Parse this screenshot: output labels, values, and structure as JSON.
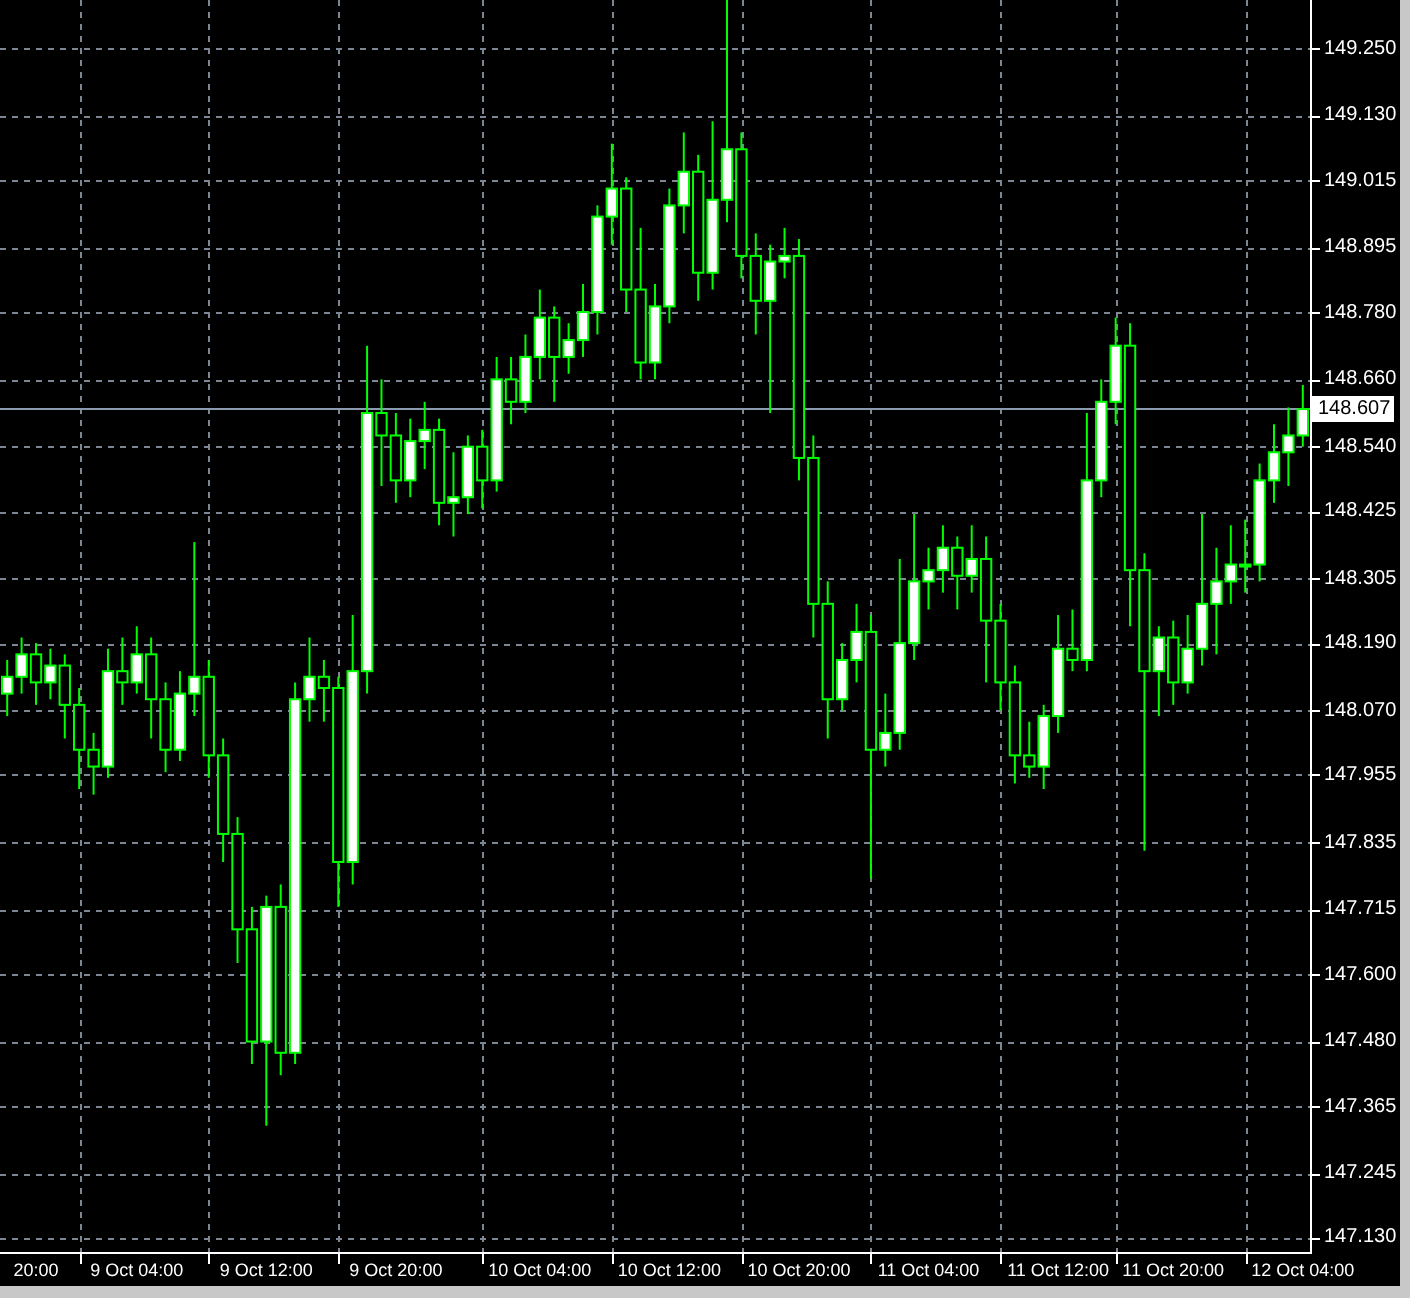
{
  "chart_data": {
    "type": "candlestick",
    "ylim": [
      147.105,
      149.336
    ],
    "grid": true,
    "ref_lines": [
      {
        "axis": "y",
        "value": 148.607,
        "label": "148.607",
        "color": "#8a9bb0"
      }
    ],
    "yticks": [
      {
        "value": 149.25,
        "label": "149.250"
      },
      {
        "value": 149.13,
        "label": "149.130"
      },
      {
        "value": 149.015,
        "label": "149.015"
      },
      {
        "value": 148.895,
        "label": "148.895"
      },
      {
        "value": 148.78,
        "label": "148.780"
      },
      {
        "value": 148.66,
        "label": "148.660"
      },
      {
        "value": 148.54,
        "label": "148.540"
      },
      {
        "value": 148.425,
        "label": "148.425"
      },
      {
        "value": 148.305,
        "label": "148.305"
      },
      {
        "value": 148.19,
        "label": "148.190"
      },
      {
        "value": 148.07,
        "label": "148.070"
      },
      {
        "value": 147.955,
        "label": "147.955"
      },
      {
        "value": 147.835,
        "label": "147.835"
      },
      {
        "value": 147.715,
        "label": "147.715"
      },
      {
        "value": 147.6,
        "label": "147.600"
      },
      {
        "value": 147.48,
        "label": "147.480"
      },
      {
        "value": 147.365,
        "label": "147.365"
      },
      {
        "value": 147.245,
        "label": "147.245"
      },
      {
        "value": 147.13,
        "label": "147.130"
      }
    ],
    "categories": [
      null,
      null,
      "20:00",
      null,
      null,
      null,
      null,
      null,
      null,
      "9 Oct 04:00",
      null,
      null,
      null,
      null,
      null,
      null,
      null,
      null,
      "9 Oct 12:00",
      null,
      null,
      null,
      null,
      null,
      null,
      null,
      null,
      "9 Oct 20:00",
      null,
      null,
      null,
      null,
      null,
      null,
      null,
      null,
      null,
      "10 Oct 04:00",
      null,
      null,
      null,
      null,
      null,
      null,
      null,
      null,
      "10 Oct 12:00",
      null,
      null,
      null,
      null,
      null,
      null,
      null,
      null,
      "10 Oct 20:00",
      null,
      null,
      null,
      null,
      null,
      null,
      null,
      null,
      "11 Oct 04:00",
      null,
      null,
      null,
      null,
      null,
      null,
      null,
      null,
      "11 Oct 12:00",
      null,
      null,
      null,
      null,
      null,
      null,
      null,
      "11 Oct 20:00",
      null,
      null,
      null,
      null,
      null,
      null,
      null,
      null,
      "12 Oct 04:00"
    ],
    "ohlc": [
      [
        148.1,
        148.16,
        148.06,
        148.13
      ],
      [
        148.13,
        148.2,
        148.1,
        148.17
      ],
      [
        148.17,
        148.19,
        148.08,
        148.12
      ],
      [
        148.12,
        148.18,
        148.09,
        148.15
      ],
      [
        148.15,
        148.17,
        148.02,
        148.08
      ],
      [
        148.08,
        148.11,
        147.93,
        148.0
      ],
      [
        148.0,
        148.03,
        147.92,
        147.97
      ],
      [
        147.97,
        148.18,
        147.95,
        148.14
      ],
      [
        148.14,
        148.2,
        148.08,
        148.12
      ],
      [
        148.12,
        148.22,
        148.1,
        148.17
      ],
      [
        148.17,
        148.2,
        148.02,
        148.09
      ],
      [
        148.09,
        148.12,
        147.96,
        148.0
      ],
      [
        148.0,
        148.14,
        147.98,
        148.1
      ],
      [
        148.1,
        148.37,
        148.06,
        148.13
      ],
      [
        148.13,
        148.16,
        147.95,
        147.99
      ],
      [
        147.99,
        148.02,
        147.8,
        147.85
      ],
      [
        147.85,
        147.88,
        147.62,
        147.68
      ],
      [
        147.68,
        147.72,
        147.44,
        147.48
      ],
      [
        147.48,
        147.74,
        147.33,
        147.72
      ],
      [
        147.72,
        147.76,
        147.42,
        147.46
      ],
      [
        147.46,
        148.12,
        147.44,
        148.09
      ],
      [
        148.09,
        148.2,
        148.05,
        148.13
      ],
      [
        148.13,
        148.16,
        148.05,
        148.11
      ],
      [
        148.11,
        148.13,
        147.72,
        147.8
      ],
      [
        147.8,
        148.24,
        147.76,
        148.14
      ],
      [
        148.14,
        148.72,
        148.1,
        148.6
      ],
      [
        148.6,
        148.66,
        148.47,
        148.56
      ],
      [
        148.56,
        148.6,
        148.44,
        148.48
      ],
      [
        148.48,
        148.59,
        148.45,
        148.55
      ],
      [
        148.55,
        148.62,
        148.5,
        148.57
      ],
      [
        148.57,
        148.59,
        148.4,
        148.44
      ],
      [
        148.44,
        148.53,
        148.38,
        148.45
      ],
      [
        148.45,
        148.56,
        148.42,
        148.54
      ],
      [
        148.54,
        148.57,
        148.43,
        148.48
      ],
      [
        148.48,
        148.7,
        148.46,
        148.66
      ],
      [
        148.66,
        148.7,
        148.58,
        148.62
      ],
      [
        148.62,
        148.74,
        148.6,
        148.7
      ],
      [
        148.7,
        148.82,
        148.66,
        148.77
      ],
      [
        148.77,
        148.79,
        148.62,
        148.7
      ],
      [
        148.7,
        148.76,
        148.67,
        148.73
      ],
      [
        148.73,
        148.83,
        148.7,
        148.78
      ],
      [
        148.78,
        148.97,
        148.74,
        148.95
      ],
      [
        148.95,
        149.08,
        148.9,
        149.0
      ],
      [
        149.0,
        149.02,
        148.78,
        148.82
      ],
      [
        148.82,
        148.93,
        148.66,
        148.69
      ],
      [
        148.69,
        148.83,
        148.66,
        148.79
      ],
      [
        148.79,
        149.0,
        148.76,
        148.97
      ],
      [
        148.97,
        149.1,
        148.92,
        149.03
      ],
      [
        149.03,
        149.06,
        148.8,
        148.85
      ],
      [
        148.85,
        149.12,
        148.82,
        148.98
      ],
      [
        148.98,
        149.34,
        148.94,
        149.07
      ],
      [
        149.07,
        149.1,
        148.84,
        148.88
      ],
      [
        148.88,
        148.92,
        148.74,
        148.8
      ],
      [
        148.8,
        148.9,
        148.6,
        148.87
      ],
      [
        148.87,
        148.93,
        148.84,
        148.88
      ],
      [
        148.88,
        148.91,
        148.48,
        148.52
      ],
      [
        148.52,
        148.56,
        148.2,
        148.26
      ],
      [
        148.26,
        148.3,
        148.02,
        148.09
      ],
      [
        148.09,
        148.19,
        148.07,
        148.16
      ],
      [
        148.16,
        148.26,
        148.12,
        148.21
      ],
      [
        148.21,
        148.24,
        147.77,
        148.0
      ],
      [
        148.0,
        148.1,
        147.97,
        148.03
      ],
      [
        148.03,
        148.34,
        148.0,
        148.19
      ],
      [
        148.19,
        148.42,
        148.16,
        148.3
      ],
      [
        148.3,
        148.36,
        148.25,
        148.32
      ],
      [
        148.32,
        148.4,
        148.28,
        148.36
      ],
      [
        148.36,
        148.38,
        148.25,
        148.31
      ],
      [
        148.31,
        148.4,
        148.28,
        148.34
      ],
      [
        148.34,
        148.38,
        148.12,
        148.23
      ],
      [
        148.23,
        148.26,
        148.07,
        148.12
      ],
      [
        148.12,
        148.15,
        147.94,
        147.99
      ],
      [
        147.99,
        148.05,
        147.95,
        147.97
      ],
      [
        147.97,
        148.08,
        147.93,
        148.06
      ],
      [
        148.06,
        148.24,
        148.03,
        148.18
      ],
      [
        148.18,
        148.25,
        148.14,
        148.16
      ],
      [
        148.16,
        148.6,
        148.14,
        148.48
      ],
      [
        148.48,
        148.66,
        148.45,
        148.62
      ],
      [
        148.62,
        148.77,
        148.58,
        148.72
      ],
      [
        148.72,
        148.76,
        148.22,
        148.32
      ],
      [
        148.32,
        148.35,
        147.82,
        148.14
      ],
      [
        148.14,
        148.22,
        148.06,
        148.2
      ],
      [
        148.2,
        148.23,
        148.08,
        148.12
      ],
      [
        148.12,
        148.24,
        148.1,
        148.18
      ],
      [
        148.18,
        148.42,
        148.15,
        148.26
      ],
      [
        148.26,
        148.36,
        148.17,
        148.3
      ],
      [
        148.3,
        148.4,
        148.26,
        148.33
      ],
      [
        148.33,
        148.41,
        148.28,
        148.33
      ],
      [
        148.33,
        148.51,
        148.3,
        148.48
      ],
      [
        148.48,
        148.58,
        148.44,
        148.53
      ],
      [
        148.53,
        148.61,
        148.47,
        148.56
      ],
      [
        148.56,
        148.65,
        148.54,
        148.607
      ]
    ]
  }
}
